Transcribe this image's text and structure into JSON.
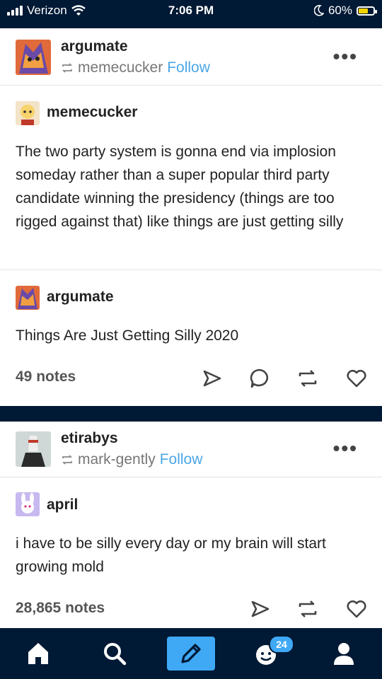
{
  "status_bar": {
    "carrier": "Verizon",
    "time": "7:06 PM",
    "battery": "60%",
    "battery_level": 0.6
  },
  "posts": [
    {
      "blog": "argumate",
      "reblogged_from": "memecucker",
      "follow_label": "Follow",
      "more_label": "•••",
      "entries": [
        {
          "author": "memecucker",
          "text": "The two party system is gonna end via implosion someday rather than a super popular third party candidate winning the presidency (things are too rigged against that) like things are just getting silly"
        },
        {
          "author": "argumate",
          "text": "Things Are Just Getting Silly 2020"
        }
      ],
      "notes": "49 notes"
    },
    {
      "blog": "etirabys",
      "reblogged_from": "mark-gently",
      "follow_label": "Follow",
      "more_label": "•••",
      "entries": [
        {
          "author": "april",
          "text": "i have to be silly every day or my brain will start growing mold"
        }
      ],
      "notes": "28,865 notes"
    }
  ],
  "bottom_nav": {
    "items": [
      "home-icon",
      "search-icon",
      "compose-icon",
      "activity-icon",
      "account-icon"
    ],
    "activity_badge": "24"
  },
  "colors": {
    "navy": "#001935",
    "accent_blue": "#3fa9f5",
    "follow_blue": "#4aa6e5"
  }
}
